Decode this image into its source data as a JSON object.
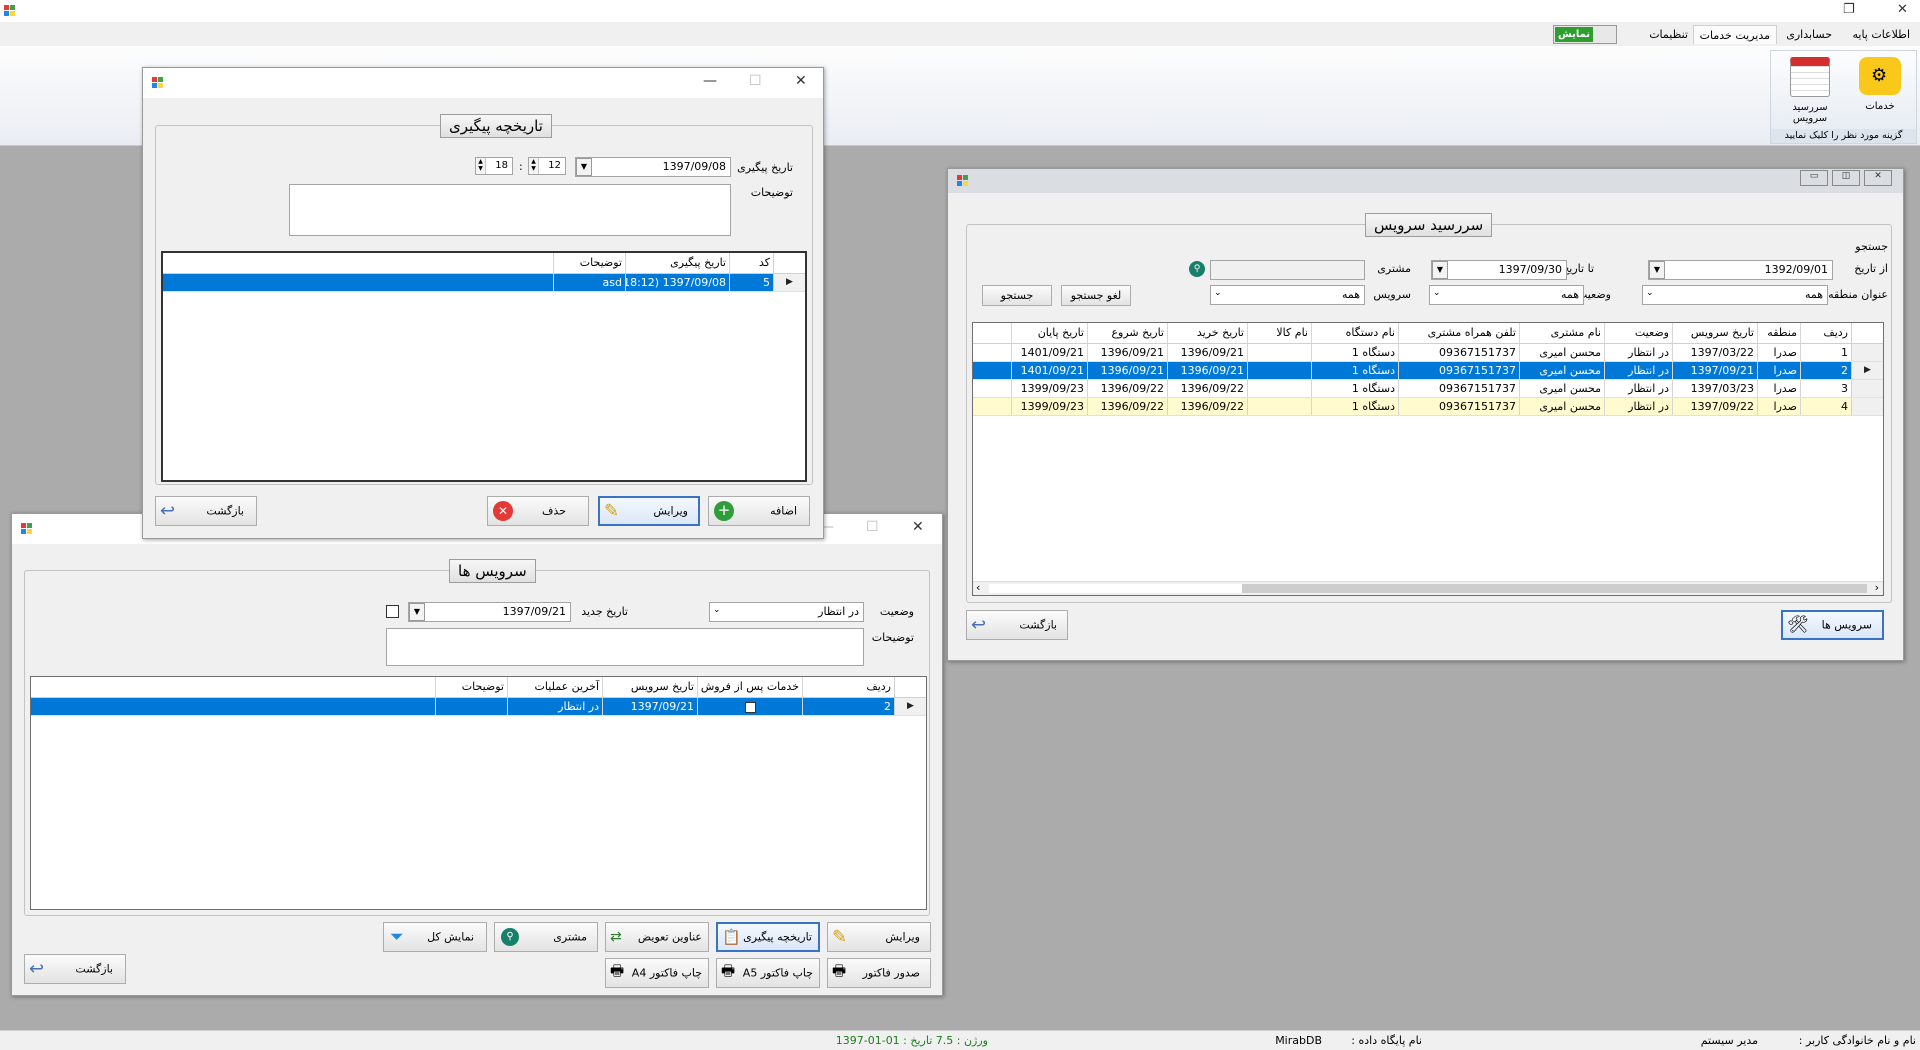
{
  "app": {
    "title": ""
  },
  "menu": {
    "items": [
      "اطلاعات پایه",
      "حسابداری",
      "مدیریت خدمات",
      "تنظیمات"
    ],
    "active_index": 2,
    "toggle_label": "نمایش"
  },
  "ribbon": {
    "services_label": "خدمات",
    "service_due_label": "سررسید سرویس",
    "group_caption": "گزینه مورد نظر را کلیک نمایید"
  },
  "due_window": {
    "title": "سررسید سرویس",
    "search_label": "جستجو",
    "from_date_label": "از تاریخ",
    "from_date_value": "1392/09/01",
    "to_date_label": "تا تاریخ",
    "to_date_value": "1397/09/30",
    "customer_label": "مشتری",
    "customer_value": "",
    "region_title_label": "عنوان منطقه",
    "region_value": "همه",
    "status_label": "وضعیت",
    "status_value": "همه",
    "service_label": "سرویس",
    "service_value": "همه",
    "cancel_search_label": "لغو جستجو",
    "search_button_label": "جستجو",
    "columns": [
      "ردیف",
      "منطقه",
      "تاریخ سرویس",
      "وضعیت",
      "نام مشتری",
      "تلفن همراه مشتری",
      "نام دستگاه",
      "نام کالا",
      "تاریخ خرید",
      "تاریخ شروع",
      "تاریخ پایان"
    ],
    "rows": [
      [
        "1",
        "صدرا",
        "1397/03/22",
        "در انتظار",
        "محسن امیری",
        "09367151737",
        "دستگاه 1",
        "",
        "1396/09/21",
        "1396/09/21",
        "1401/09/21"
      ],
      [
        "2",
        "صدرا",
        "1397/09/21",
        "در انتظار",
        "محسن امیری",
        "09367151737",
        "دستگاه 1",
        "",
        "1396/09/21",
        "1396/09/21",
        "1401/09/21"
      ],
      [
        "3",
        "صدرا",
        "1397/03/23",
        "در انتظار",
        "محسن امیری",
        "09367151737",
        "دستگاه 1",
        "",
        "1396/09/22",
        "1396/09/22",
        "1399/09/23"
      ],
      [
        "4",
        "صدرا",
        "1397/09/22",
        "در انتظار",
        "محسن امیری",
        "09367151737",
        "دستگاه 1",
        "",
        "1396/09/22",
        "1396/09/22",
        "1399/09/23"
      ]
    ],
    "selected_row": 1,
    "highlight_row": 3,
    "services_button_label": "سرویس ها",
    "back_label": "بازگشت"
  },
  "followup_window": {
    "title": "تاریخچه پیگیری",
    "date_label": "تاریخ پیگیری",
    "date_value": "1397/09/08",
    "hour_value": "18",
    "minute_value": "12",
    "time_sep": ":",
    "notes_label": "توضیحات",
    "notes_value": "",
    "columns": [
      "کد",
      "تاریخ پیگیری",
      "توضیحات"
    ],
    "rows": [
      [
        "5",
        "1397/09/08 (18:12)",
        "asd"
      ]
    ],
    "add_label": "اضافه",
    "edit_label": "ویرایش",
    "delete_label": "حذف",
    "back_label": "بازگشت"
  },
  "services_window": {
    "title": "سرویس ها",
    "status_label": "وضعیت",
    "status_value": "در انتظار",
    "new_date_label": "تاریخ جدید",
    "new_date_value": "1397/09/21",
    "notes_label": "توضیحات",
    "notes_value": "",
    "columns": [
      "ردیف",
      "خدمات پس از فروش",
      "تاریخ سرویس",
      "آخرین عملیات",
      "توضیحات"
    ],
    "rows": [
      [
        "2",
        "",
        "1397/09/21",
        "در انتظار",
        ""
      ]
    ],
    "buttons": {
      "edit": "ویرایش",
      "followup": "تاریخچه پیگیری",
      "replace_titles": "عناوین تعویض",
      "customer": "مشتری",
      "show_all": "نمایش کل",
      "issue_invoice": "صدور فاکتور",
      "print_a5": "چاپ فاکتور A5",
      "print_a4": "چاپ فاکتور A4",
      "back": "بازگشت"
    }
  },
  "statusbar": {
    "user_label": "نام و نام خانوادگی کاربر :",
    "user_value": "مدیر سیستم",
    "db_label": "نام پایگاه داده :",
    "db_value": "MirabDB",
    "version_text": "ورژن : 7.5  تاریخ : 01-01-1397",
    "version_color": "#1b7d1b"
  },
  "colors": {
    "selection": "#0078d7",
    "highlight_row": "#fffbcf",
    "desktop": "#ababab"
  }
}
